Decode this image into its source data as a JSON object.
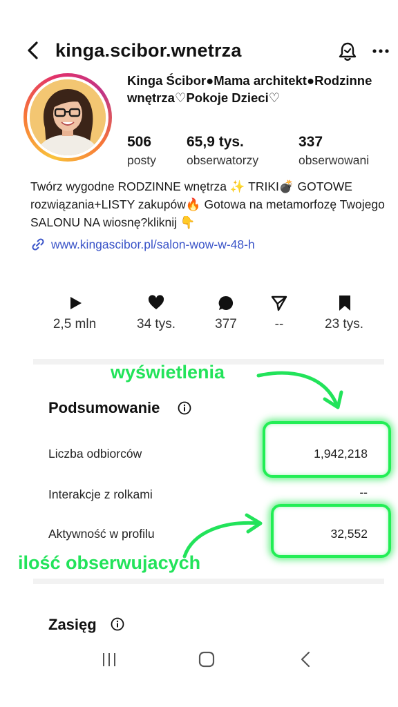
{
  "header": {
    "username": "kinga.scibor.wnetrza",
    "back_icon": "chevron-left-icon",
    "bell_icon": "bell-icon",
    "more_icon": "more-horizontal-icon"
  },
  "profile": {
    "display_name": "Kinga Ścibor●Mama architekt●Rodzinne wnętrza♡Pokoje Dzieci♡",
    "stats": [
      {
        "value": "506",
        "label": "posty"
      },
      {
        "value": "65,9 tys.",
        "label": "obserwatorzy"
      },
      {
        "value": "337",
        "label": "obserwowani"
      }
    ],
    "bio": "Twórz wygodne RODZINNE wnętrza ✨ TRIKI💣 GOTOWE rozwiązania+LISTY zakupów🔥 Gotowa na metamorfozę Twojego SALONU NA wiosnę?kliknij 👇",
    "link": "www.kingascibor.pl/salon-wow-w-48-h",
    "link_icon": "link-icon"
  },
  "metrics": [
    {
      "icon": "play-icon",
      "value": "2,5 mln"
    },
    {
      "icon": "heart-icon",
      "value": "34 tys."
    },
    {
      "icon": "comment-icon",
      "value": "377"
    },
    {
      "icon": "send-icon",
      "value": "--"
    },
    {
      "icon": "bookmark-icon",
      "value": "23 tys."
    }
  ],
  "summary": {
    "title": "Podsumowanie",
    "rows": [
      {
        "label": "Liczba odbiorców",
        "value": "1,942,218"
      },
      {
        "label": "Interakcje z rolkami",
        "value": "--"
      },
      {
        "label": "Aktywność w profilu",
        "value": "32,552"
      }
    ]
  },
  "reach": {
    "title": "Zasięg"
  },
  "annotations": {
    "top": "wyświetlenia",
    "bottom": "ilość obserwujacych",
    "color": "#22e35a"
  },
  "nav": {
    "recents_icon": "recents-icon",
    "home_icon": "home-icon",
    "back_icon": "back-icon"
  },
  "colors": {
    "link": "#3a54c8",
    "annotation_green": "#22ee55"
  }
}
